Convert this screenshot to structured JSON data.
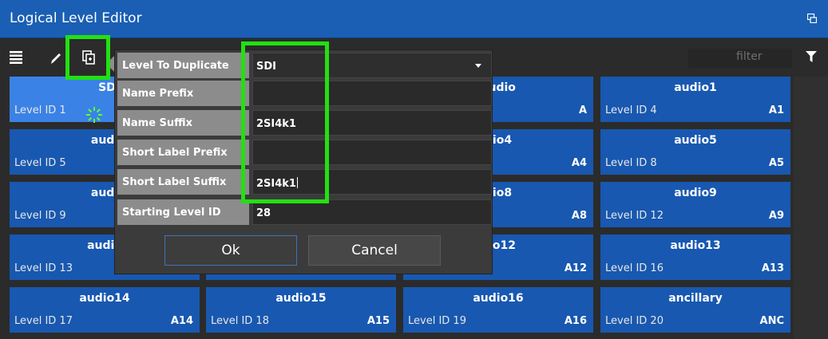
{
  "window": {
    "title": "Logical Level Editor",
    "restore_icon": "window-restore-icon"
  },
  "toolbar": {
    "icons": [
      "list-icon",
      "edit-pencil-icon",
      "duplicate-level-icon"
    ],
    "filter_placeholder": "filter",
    "filter_icon": "funnel-icon"
  },
  "levels": [
    [
      {
        "name": "SDI",
        "id": "Level ID 1",
        "short": ""
      },
      {
        "name": "",
        "id": "",
        "short": ""
      },
      {
        "name": "audio",
        "id": "",
        "short": "A"
      },
      {
        "name": "audio1",
        "id": "Level ID 4",
        "short": "A1"
      }
    ],
    [
      {
        "name": "audi",
        "id": "Level ID 5",
        "short": ""
      },
      {
        "name": "",
        "id": "",
        "short": ""
      },
      {
        "name": "dio4",
        "id": "",
        "short": "A4"
      },
      {
        "name": "audio5",
        "id": "Level ID 8",
        "short": "A5"
      }
    ],
    [
      {
        "name": "audi",
        "id": "Level ID 9",
        "short": ""
      },
      {
        "name": "",
        "id": "",
        "short": ""
      },
      {
        "name": "dio8",
        "id": "",
        "short": "A8"
      },
      {
        "name": "audio9",
        "id": "Level ID 12",
        "short": "A9"
      }
    ],
    [
      {
        "name": "audio",
        "id": "Level ID 13",
        "short": ""
      },
      {
        "name": "",
        "id": "",
        "short": ""
      },
      {
        "name": "dio12",
        "id": "",
        "short": "A12"
      },
      {
        "name": "audio13",
        "id": "Level ID 16",
        "short": "A13"
      }
    ],
    [
      {
        "name": "audio14",
        "id": "Level ID 17",
        "short": "A14"
      },
      {
        "name": "audio15",
        "id": "Level ID 18",
        "short": "A15"
      },
      {
        "name": "audio16",
        "id": "Level ID 19",
        "short": "A16"
      },
      {
        "name": "ancillary",
        "id": "Level ID 20",
        "short": "ANC"
      }
    ]
  ],
  "dialog": {
    "rows": [
      {
        "label": "Level To Duplicate",
        "value": "SDI"
      },
      {
        "label": "Name Prefix",
        "value": ""
      },
      {
        "label": "Name Suffix",
        "value": "2SI4k1"
      },
      {
        "label": "Short Label Prefix",
        "value": ""
      },
      {
        "label": "Short Label Suffix",
        "value": "2SI4k1"
      },
      {
        "label": "Starting Level ID",
        "value": "28"
      }
    ],
    "ok_label": "Ok",
    "cancel_label": "Cancel"
  },
  "colors": {
    "accent": "#1858b0",
    "highlight": "#22e012",
    "selected": "#3b82e6"
  }
}
